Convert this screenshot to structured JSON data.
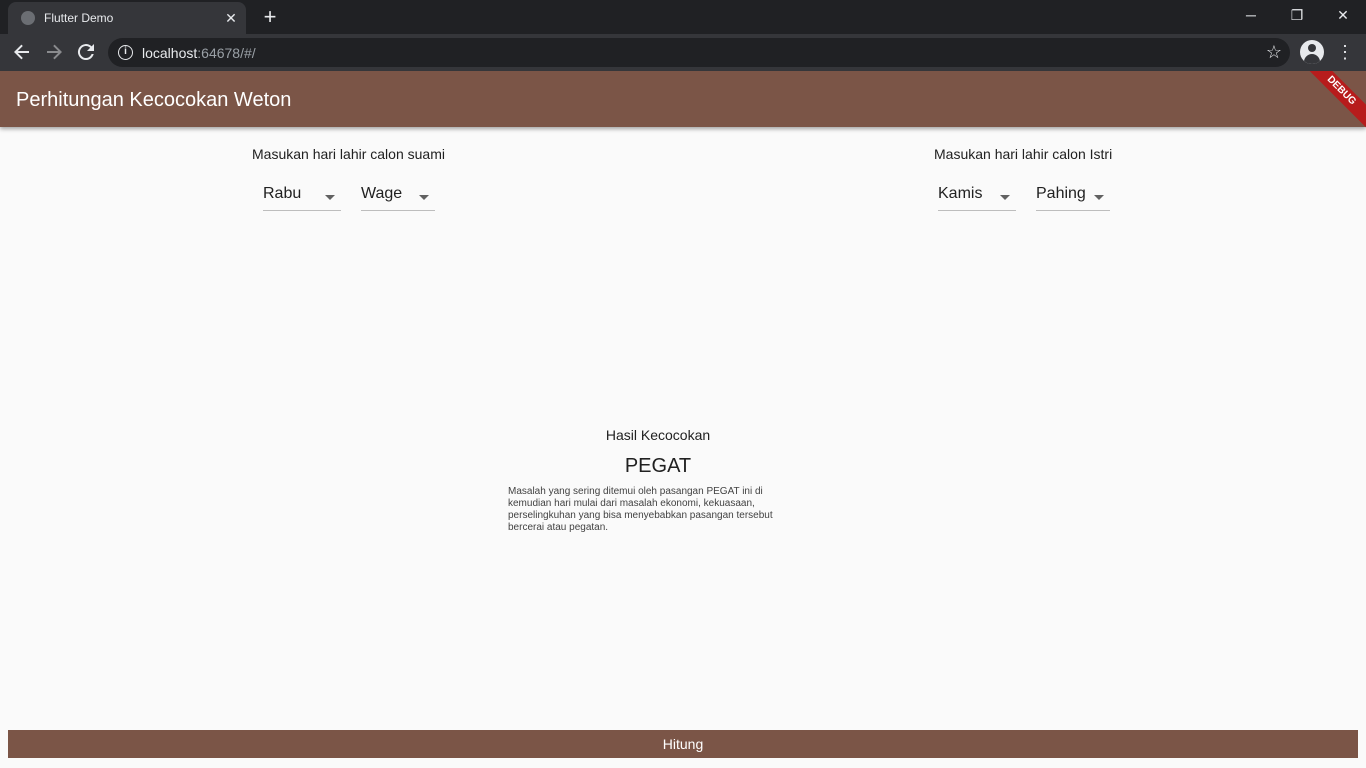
{
  "browser": {
    "tab_title": "Flutter Demo",
    "tab_close": "✕",
    "new_tab": "+",
    "url_host": "localhost",
    "url_rest": ":64678/#/",
    "window_controls": {
      "minimize": "─",
      "restore": "❐",
      "close": "✕"
    },
    "icons": {
      "back": "arrow-left-icon",
      "forward": "arrow-right-icon",
      "reload": "reload-icon",
      "info": "info-icon",
      "star": "star-icon",
      "profile": "account-icon",
      "menu": "kebab-menu-icon"
    }
  },
  "app": {
    "title": "Perhitungan Kecocokan Weton",
    "debug_banner": "DEBUG",
    "accent_color": "#7b5547",
    "husband": {
      "label": "Masukan hari lahir calon suami",
      "day": "Rabu",
      "pasaran": "Wage"
    },
    "wife": {
      "label": "Masukan hari lahir calon Istri",
      "day": "Kamis",
      "pasaran": "Pahing"
    },
    "result": {
      "label": "Hasil Kecocokan",
      "value": "PEGAT",
      "description": "Masalah yang sering ditemui oleh pasangan PEGAT ini di kemudian hari mulai dari masalah ekonomi, kekuasaan, perselingkuhan yang bisa menyebabkan pasangan tersebut bercerai atau pegatan."
    },
    "submit_label": "Hitung"
  }
}
